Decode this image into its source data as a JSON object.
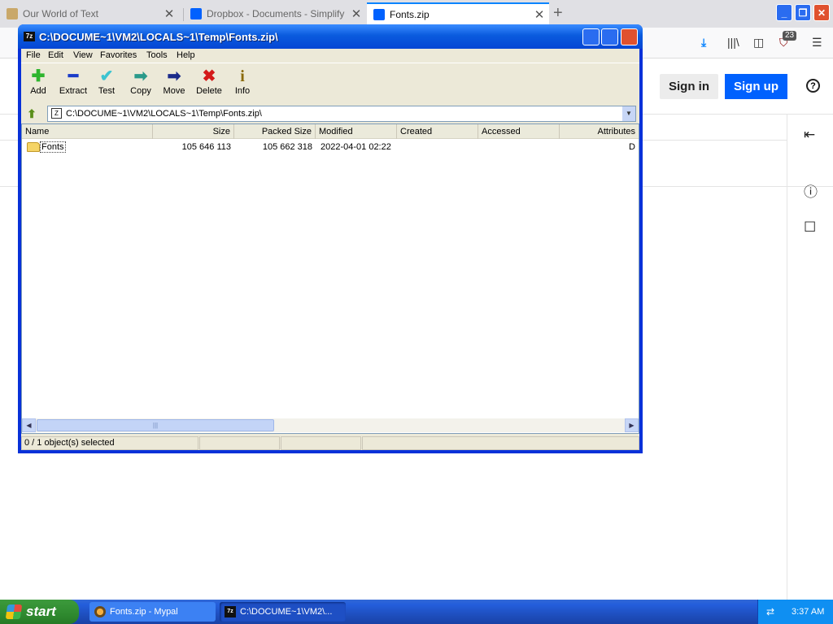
{
  "browser": {
    "tabs": [
      {
        "title": "Our World of Text",
        "icon": "page-icon",
        "active": false
      },
      {
        "title": "Dropbox - Documents - Simplify y",
        "icon": "dropbox-icon",
        "active": false
      },
      {
        "title": "Fonts.zip",
        "icon": "dropbox-icon",
        "active": true
      }
    ],
    "new_tab_glyph": "+",
    "extension_badge": "23",
    "signin_label": "Sign in",
    "signup_label": "Sign up",
    "help_glyph": "?",
    "colors": {
      "accent": "#0061fe",
      "tab_highlight": "#0a84ff"
    }
  },
  "window": {
    "title": "C:\\DOCUME~1\\VM2\\LOCALS~1\\Temp\\Fonts.zip\\",
    "title_icon": "7z",
    "menu": [
      "File",
      "Edit",
      "View",
      "Favorites",
      "Tools",
      "Help"
    ],
    "toolbar": [
      {
        "label": "Add",
        "icon": "add-icon",
        "glyph": "✚",
        "color": "#2fb52f"
      },
      {
        "label": "Extract",
        "icon": "extract-icon",
        "glyph": "━",
        "color": "#1a3cc8"
      },
      {
        "label": "Test",
        "icon": "test-icon",
        "glyph": "✔",
        "color": "#3cc4d0"
      },
      {
        "label": "Copy",
        "icon": "copy-icon",
        "glyph": "➡",
        "color": "#2a9a8a"
      },
      {
        "label": "Move",
        "icon": "move-icon",
        "glyph": "➡",
        "color": "#1a2a8a"
      },
      {
        "label": "Delete",
        "icon": "delete-icon",
        "glyph": "✖",
        "color": "#d41a1a"
      },
      {
        "label": "Info",
        "icon": "info-icon",
        "glyph": "i",
        "color": "#8a6a0a"
      }
    ],
    "address": "C:\\DOCUME~1\\VM2\\LOCALS~1\\Temp\\Fonts.zip\\",
    "columns": [
      "Name",
      "Size",
      "Packed Size",
      "Modified",
      "Created",
      "Accessed",
      "Attributes"
    ],
    "rows": [
      {
        "name": "Fonts",
        "size": "105 646 113",
        "packed_size": "105 662 318",
        "modified": "2022-04-01 02:22",
        "created": "",
        "accessed": "",
        "attributes": "D"
      }
    ],
    "status": [
      "0 / 1 object(s) selected",
      "",
      "",
      ""
    ]
  },
  "taskbar": {
    "start_label": "start",
    "items": [
      {
        "label": "Fonts.zip - Mypal",
        "icon": "mypal-icon"
      },
      {
        "label": "C:\\DOCUME~1\\VM2\\...",
        "icon": "7zip-icon"
      }
    ],
    "clock": "3:37 AM"
  }
}
